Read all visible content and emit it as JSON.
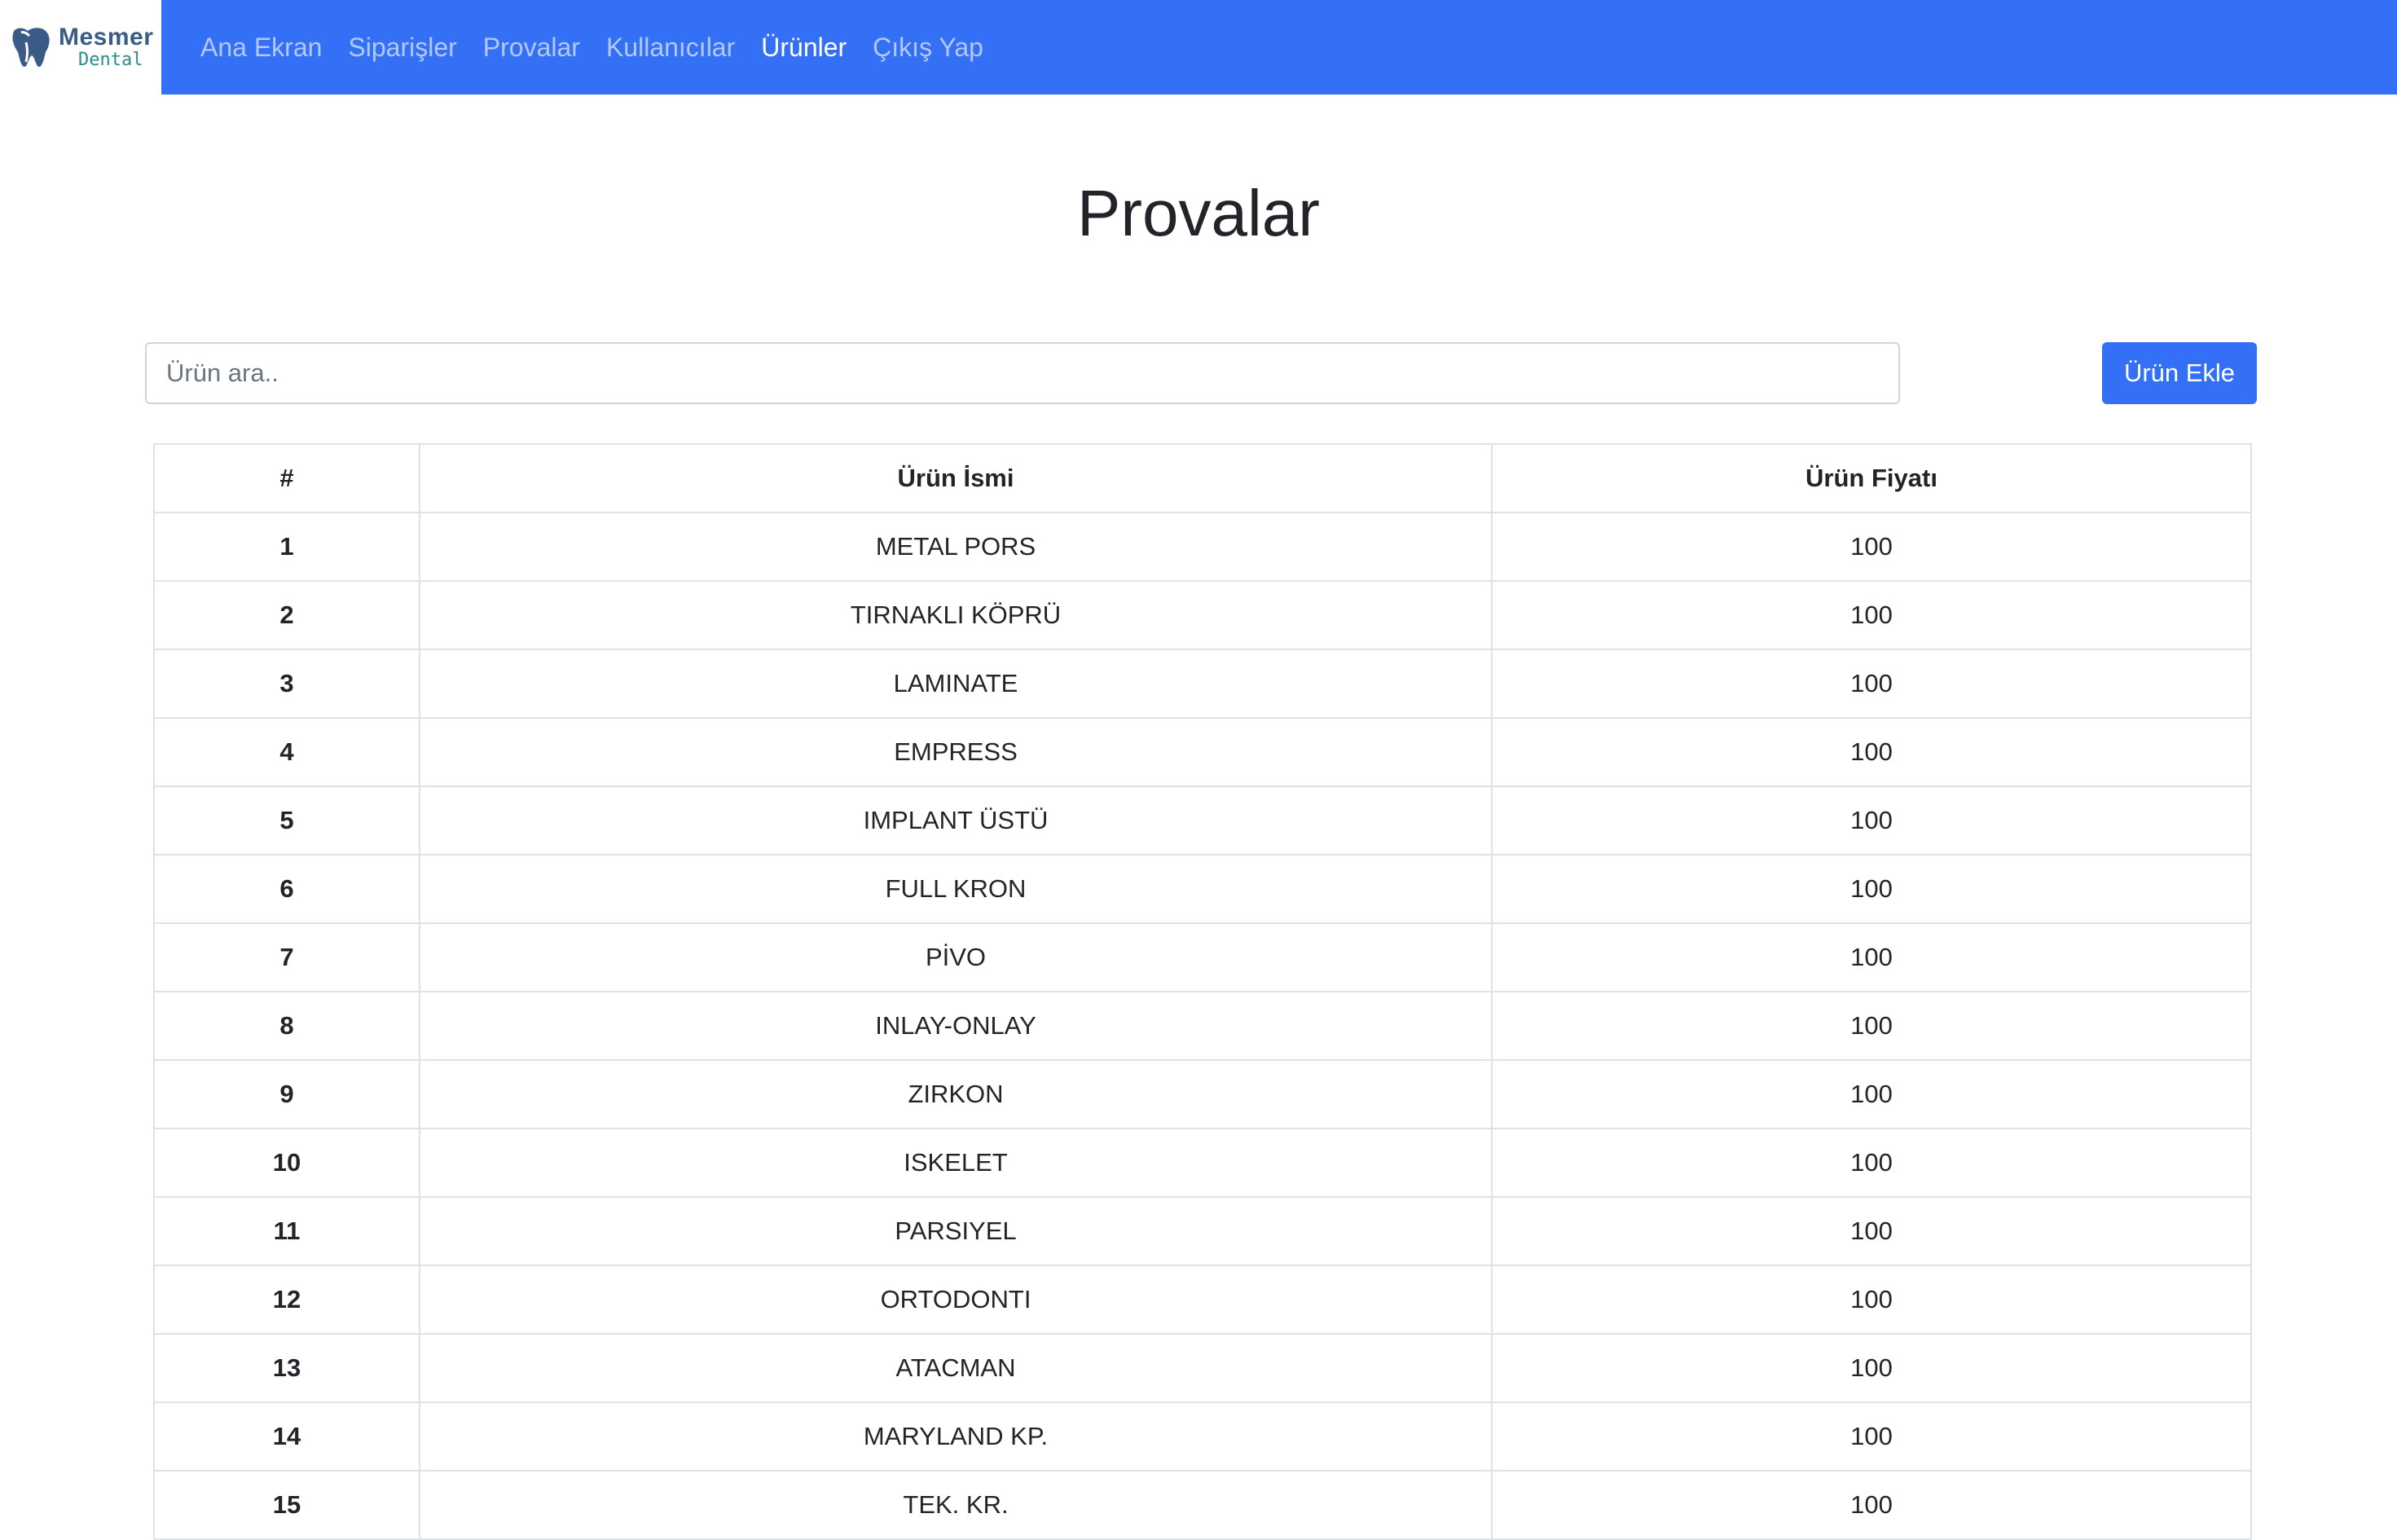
{
  "brand": {
    "name": "Mesmer",
    "sub": "Dental"
  },
  "nav": [
    {
      "label": "Ana Ekran",
      "active": false
    },
    {
      "label": "Siparişler",
      "active": false
    },
    {
      "label": "Provalar",
      "active": false
    },
    {
      "label": "Kullanıcılar",
      "active": false
    },
    {
      "label": "Ürünler",
      "active": true
    },
    {
      "label": "Çıkış Yap",
      "active": false
    }
  ],
  "page": {
    "title": "Provalar"
  },
  "search": {
    "placeholder": "Ürün ara..",
    "value": ""
  },
  "actions": {
    "add_label": "Ürün Ekle"
  },
  "table": {
    "headers": [
      "#",
      "Ürün İsmi",
      "Ürün Fiyatı"
    ],
    "rows": [
      [
        "1",
        "METAL PORS",
        "100"
      ],
      [
        "2",
        "TIRNAKLI KÖPRÜ",
        "100"
      ],
      [
        "3",
        "LAMINATE",
        "100"
      ],
      [
        "4",
        "EMPRESS",
        "100"
      ],
      [
        "5",
        "IMPLANT ÜSTÜ",
        "100"
      ],
      [
        "6",
        "FULL KRON",
        "100"
      ],
      [
        "7",
        "PİVO",
        "100"
      ],
      [
        "8",
        "INLAY-ONLAY",
        "100"
      ],
      [
        "9",
        "ZIRKON",
        "100"
      ],
      [
        "10",
        "ISKELET",
        "100"
      ],
      [
        "11",
        "PARSIYEL",
        "100"
      ],
      [
        "12",
        "ORTODONTI",
        "100"
      ],
      [
        "13",
        "ATACMAN",
        "100"
      ],
      [
        "14",
        "MARYLAND KP.",
        "100"
      ],
      [
        "15",
        "TEK. KR.",
        "100"
      ]
    ]
  },
  "colors": {
    "primary": "#3470f5",
    "text": "#212529",
    "border": "#dee2e6"
  }
}
